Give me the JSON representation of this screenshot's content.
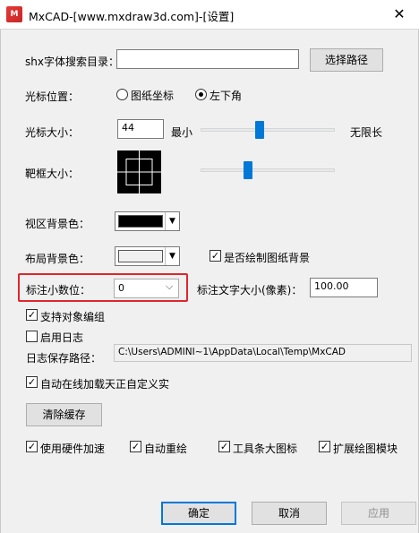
{
  "window": {
    "title": "MxCAD-[www.mxdraw3d.com]-[设置]",
    "icon_text": "M",
    "close_glyph": "✕"
  },
  "shx": {
    "label": "shx字体搜索目录：",
    "value": "",
    "button": "选择路径"
  },
  "cursor_pos": {
    "label": "光标位置：",
    "opt1": "图纸坐标",
    "opt2": "左下角",
    "selected": "左下角"
  },
  "cursor_size": {
    "label": "光标大小：",
    "value": "44",
    "min_label": "最小",
    "max_label": "无限长",
    "slider_level": 0.44
  },
  "target_size": {
    "label": "靶框大小：",
    "slider_level": 0.35
  },
  "viewport_bg": {
    "label": "视区背景色：",
    "color": "#000000"
  },
  "layout_bg": {
    "label": "布局背景色：",
    "color": "#f0f0f0",
    "draw_paper_label": "是否绘制图纸背景",
    "draw_paper_checked": true
  },
  "dim_decimals": {
    "label": "标注小数位：",
    "value": "0"
  },
  "dim_text_size": {
    "label": "标注文字大小(像素)：",
    "value": "100.00"
  },
  "options": {
    "group_edit": "支持对象编组",
    "enable_log": "启用日志",
    "log_path_label": "日志保存路径：",
    "log_path_value": "C:\\Users\\ADMINI~1\\AppData\\Local\\Temp\\MxCAD",
    "auto_load": "自动在线加载天正自定义实"
  },
  "checks": {
    "group_edit": true,
    "enable_log": false,
    "auto_load": true,
    "hw_accel": true,
    "auto_regen": true,
    "big_icons": true,
    "ext_module": true
  },
  "clear_cache": "清除缓存",
  "bottom_checks": {
    "hw_accel": "使用硬件加速",
    "auto_regen": "自动重绘",
    "big_icons": "工具条大图标",
    "ext_module": "扩展绘图模块"
  },
  "buttons": {
    "ok": "确定",
    "cancel": "取消",
    "apply": "应用"
  }
}
